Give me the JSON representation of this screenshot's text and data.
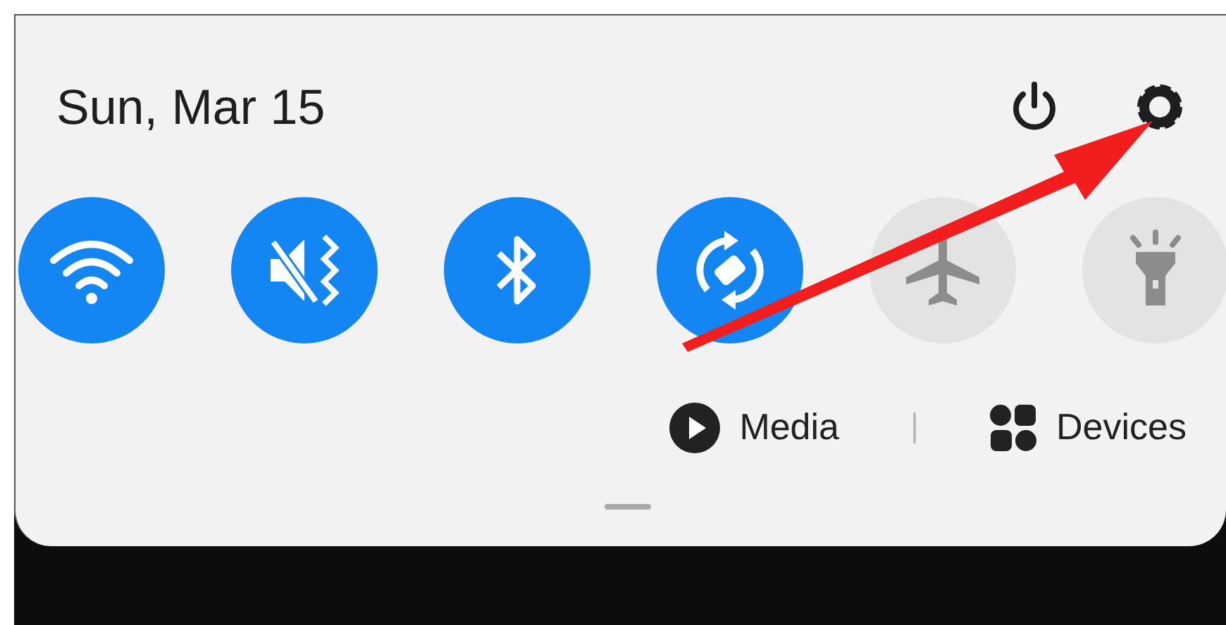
{
  "header": {
    "date": "Sun, Mar 15"
  },
  "header_icons": [
    {
      "kind": "power"
    },
    {
      "kind": "settings"
    }
  ],
  "toggles": [
    {
      "kind": "wifi",
      "on": true
    },
    {
      "kind": "mute",
      "on": true
    },
    {
      "kind": "bluetooth",
      "on": true
    },
    {
      "kind": "rotate",
      "on": true
    },
    {
      "kind": "airplane",
      "on": false
    },
    {
      "kind": "flashlight",
      "on": false
    }
  ],
  "shortcuts": [
    {
      "kind": "media",
      "label": "Media"
    },
    {
      "kind": "devices",
      "label": "Devices"
    }
  ],
  "overlay": {
    "kind": "arrow"
  }
}
